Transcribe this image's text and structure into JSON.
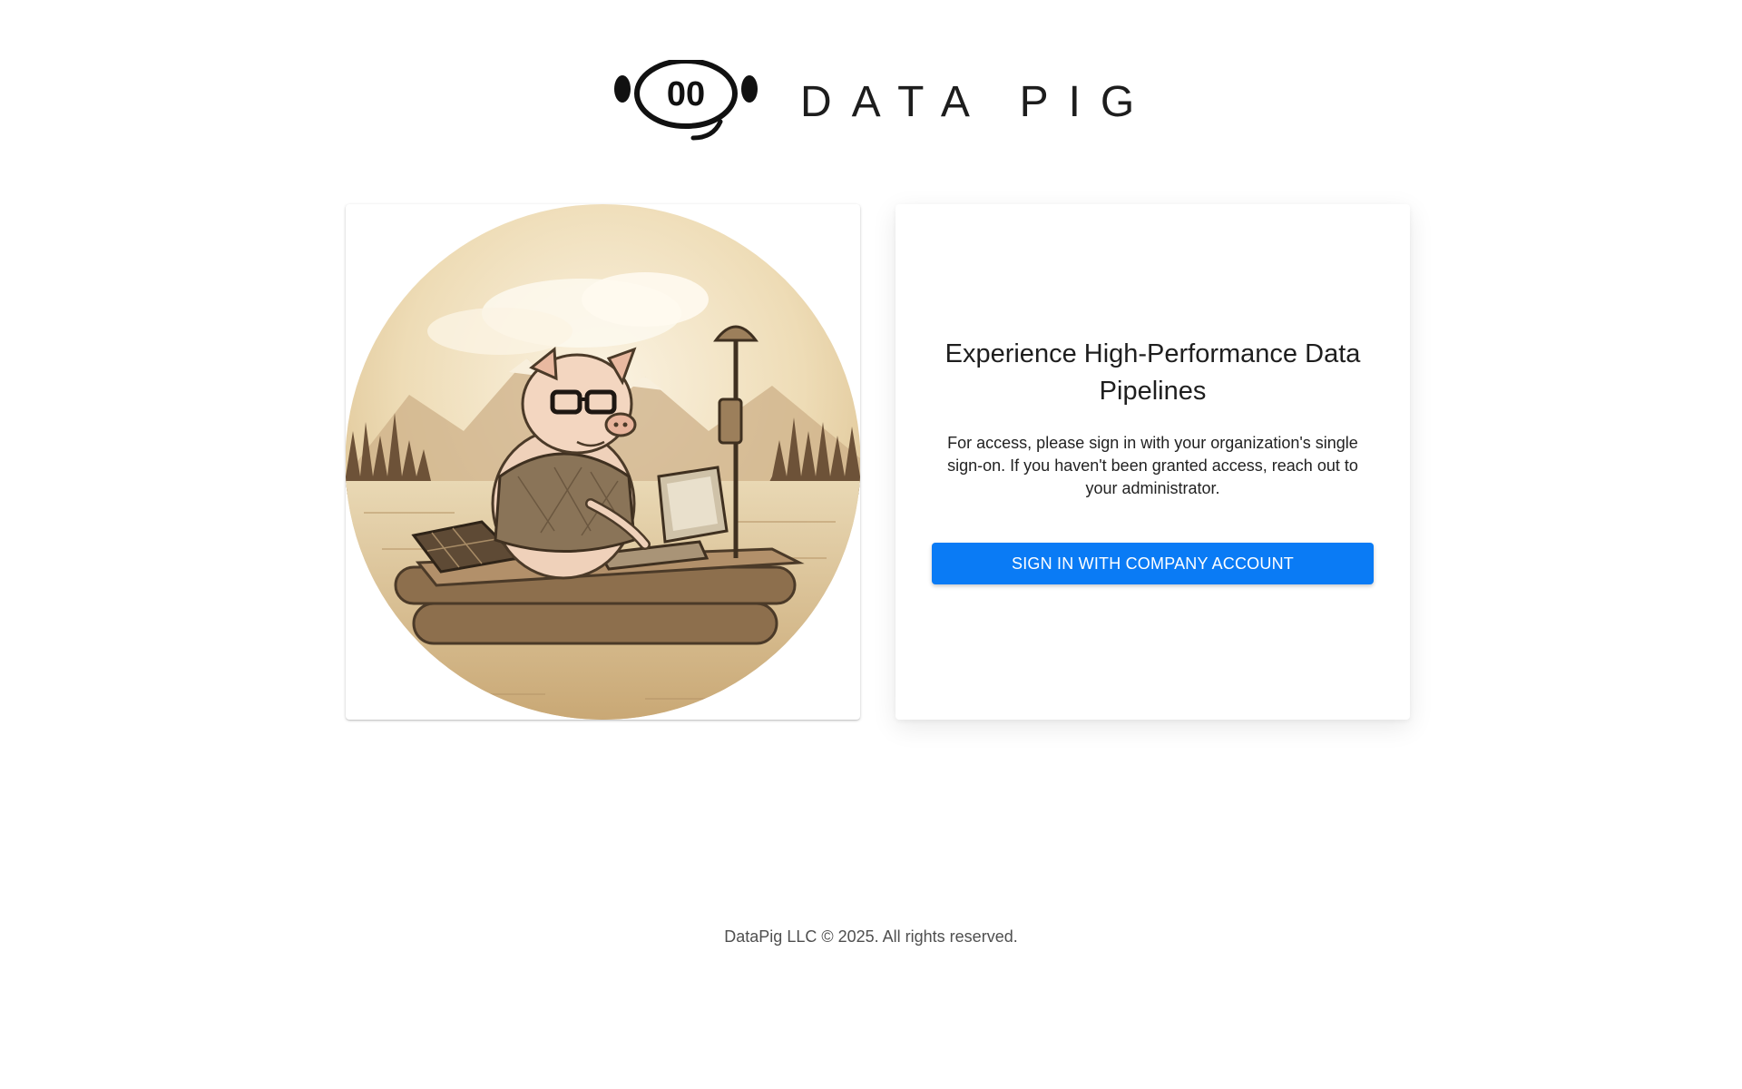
{
  "brand": {
    "name": "DATA PIG",
    "logo_icon": "pig-snout-icon",
    "logo_glyph": "00"
  },
  "illustration": {
    "subject": "pig-at-computer-on-raft-icon"
  },
  "login": {
    "headline": "Experience High-Performance Data Pipelines",
    "description": "For access, please sign in with your organization's single sign-on. If you haven't been granted access, reach out to your administrator.",
    "signin_label": "SIGN IN WITH COMPANY ACCOUNT"
  },
  "footer": {
    "text": "DataPig LLC © 2025. All rights reserved."
  },
  "colors": {
    "primary_button": "#0a7bf5",
    "background": "#ffffff",
    "sepia": "#d9bd8b"
  }
}
